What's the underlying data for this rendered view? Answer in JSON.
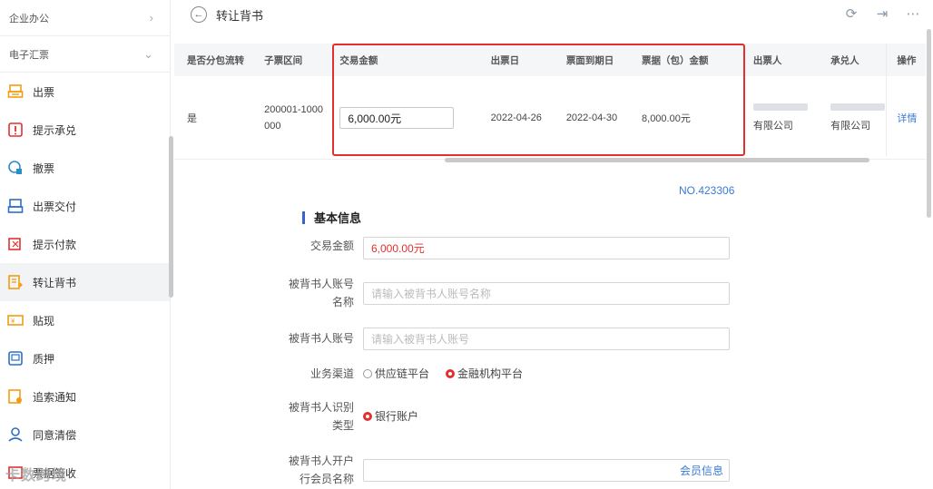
{
  "sidebar": {
    "sections": [
      {
        "label": "企业办公",
        "chevron": "chevron-right-icon"
      },
      {
        "label": "电子汇票",
        "chevron": "chevron-down-icon"
      }
    ],
    "items": [
      {
        "label": "出票",
        "icon": "printer-icon"
      },
      {
        "label": "提示承兑",
        "icon": "alert-icon"
      },
      {
        "label": "撤票",
        "icon": "revoke-icon"
      },
      {
        "label": "出票交付",
        "icon": "deliver-icon"
      },
      {
        "label": "提示付款",
        "icon": "payment-icon"
      },
      {
        "label": "转让背书",
        "icon": "endorse-icon",
        "active": true
      },
      {
        "label": "贴现",
        "icon": "discount-icon"
      },
      {
        "label": "质押",
        "icon": "pledge-icon"
      },
      {
        "label": "追索通知",
        "icon": "recourse-icon"
      },
      {
        "label": "同意清偿",
        "icon": "settle-icon"
      },
      {
        "label": "票据签收",
        "icon": "sign-icon"
      }
    ]
  },
  "header": {
    "title": "转让背书"
  },
  "table": {
    "columns": [
      "是否分包流转",
      "子票区间",
      "交易金额",
      "出票日",
      "票面到期日",
      "票据（包）金额",
      "出票人",
      "承兑人",
      "操作"
    ],
    "row": {
      "split": "是",
      "range_line1": "200001-1000",
      "range_line2": "000",
      "amount": "6,000.00元",
      "issue_date": "2022-04-26",
      "due_date": "2022-04-30",
      "bill_amount": "8,000.00元",
      "drawer": "有限公司",
      "acceptor": "有限公司",
      "action": "详情"
    }
  },
  "form": {
    "no": "NO.423306",
    "section_title": "基本信息",
    "amount_label": "交易金额",
    "amount_value": "6,000.00元",
    "name_label_1": "被背书人账号",
    "name_label_2": "名称",
    "name_placeholder": "请输入被背书人账号名称",
    "account_label": "被背书人账号",
    "account_placeholder": "请输入被背书人账号",
    "channel_label": "业务渠道",
    "channel_options": [
      "供应链平台",
      "金融机构平台"
    ],
    "channel_selected": "金融机构平台",
    "id_label_1": "被背书人识别",
    "id_label_2": "类型",
    "id_option": "银行账户",
    "member_label_1": "被背书人开户",
    "member_label_2": "行会员名称",
    "member_link": "会员信息"
  },
  "watermark": "卡数跨境",
  "colors": {
    "accent": "#3a7bd5",
    "highlight_red": "#e23030",
    "brand_blue": "#3a62c8"
  }
}
